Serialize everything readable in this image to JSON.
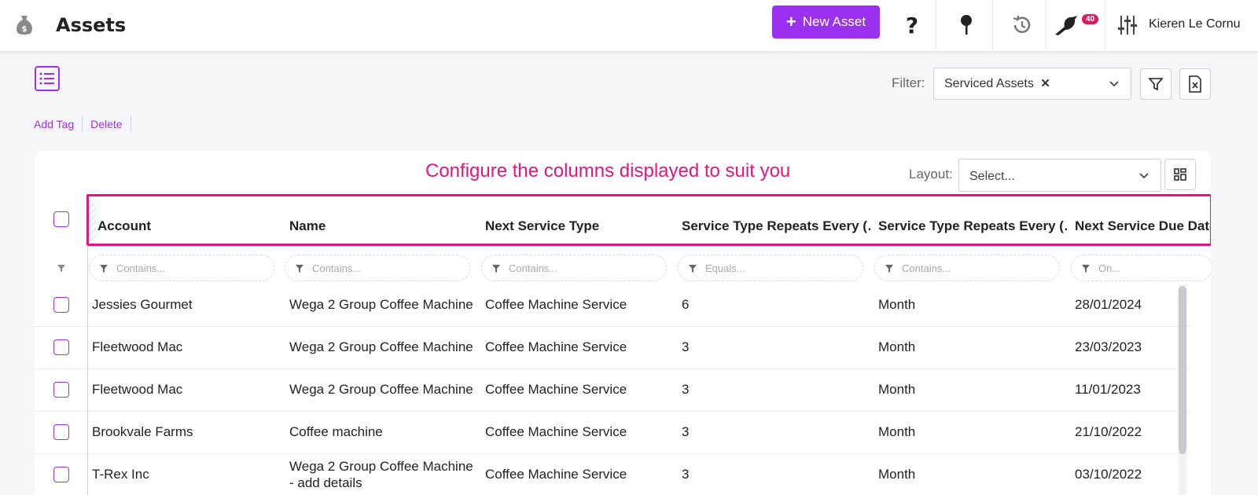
{
  "header": {
    "title": "Assets",
    "new_asset_label": "New Asset",
    "notification_count": "40",
    "user_name": "Kieren Le Cornu"
  },
  "toolbar": {
    "filter_label": "Filter:",
    "filter_value": "Serviced Assets",
    "actions": [
      "Add Tag",
      "Delete"
    ]
  },
  "grid": {
    "callout": "Configure the columns displayed to suit you",
    "layout_label": "Layout:",
    "layout_placeholder": "Select...",
    "columns": [
      "Account",
      "Name",
      "Next Service Type",
      "Service Type Repeats Every (…",
      "Service Type Repeats Every (…",
      "Next Service Due Date"
    ],
    "column_filters": [
      "Contains...",
      "Contains...",
      "Contains...",
      "Equals...",
      "Contains...",
      "On..."
    ],
    "rows": [
      {
        "account": "Jessies Gourmet",
        "name": "Wega 2 Group Coffee Machine",
        "name2": "",
        "service_type": "Coffee Machine Service",
        "repeats": "6",
        "unit": "Month",
        "due": "28/01/2024"
      },
      {
        "account": "Fleetwood Mac",
        "name": "Wega 2 Group Coffee Machine",
        "name2": "",
        "service_type": "Coffee Machine Service",
        "repeats": "3",
        "unit": "Month",
        "due": "23/03/2023"
      },
      {
        "account": "Fleetwood Mac",
        "name": "Wega 2 Group Coffee Machine",
        "name2": "",
        "service_type": "Coffee Machine Service",
        "repeats": "3",
        "unit": "Month",
        "due": "11/01/2023"
      },
      {
        "account": "Brookvale Farms",
        "name": "Coffee machine",
        "name2": "",
        "service_type": "Coffee Machine Service",
        "repeats": "3",
        "unit": "Month",
        "due": "21/10/2022"
      },
      {
        "account": "T-Rex Inc",
        "name": "Wega 2 Group Coffee Machine",
        "name2": "- add details",
        "service_type": "Coffee Machine Service",
        "repeats": "3",
        "unit": "Month",
        "due": "03/10/2022"
      }
    ]
  },
  "colors": {
    "accent": "#9b30f0",
    "highlight": "#e3157f",
    "badge": "#d81b60"
  },
  "icons": [
    "money-bag-icon",
    "help-icon",
    "pin-icon",
    "history-icon",
    "bird-icon",
    "settings-sliders-icon",
    "list-view-icon",
    "chevron-down-icon",
    "filter-icon",
    "excel-export-icon",
    "grid-layout-icon"
  ]
}
